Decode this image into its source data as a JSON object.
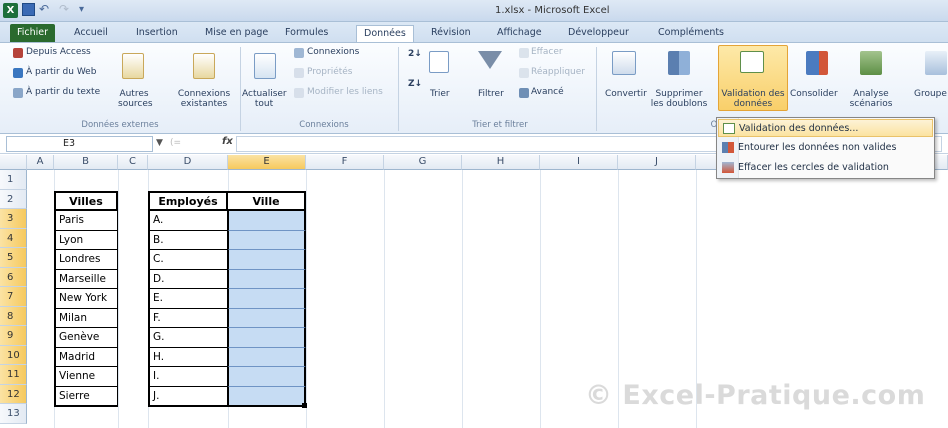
{
  "window": {
    "title": "1.xlsx - Microsoft Excel",
    "logo": "X"
  },
  "tabs": [
    {
      "label": "Fichier"
    },
    {
      "label": "Accueil"
    },
    {
      "label": "Insertion"
    },
    {
      "label": "Mise en page"
    },
    {
      "label": "Formules"
    },
    {
      "label": "Données"
    },
    {
      "label": "Révision"
    },
    {
      "label": "Affichage"
    },
    {
      "label": "Développeur"
    },
    {
      "label": "Compléments"
    }
  ],
  "ribbon": {
    "external": {
      "from_access": "Depuis Access",
      "from_web": "À partir du Web",
      "from_text": "À partir du texte",
      "other_sources": "Autres",
      "other_sources2": "sources",
      "existing": "Connexions",
      "existing2": "existantes",
      "label": "Données externes"
    },
    "connections": {
      "refresh": "Actualiser",
      "refresh2": "tout",
      "connections": "Connexions",
      "properties": "Propriétés",
      "edit_links": "Modifier les liens",
      "label": "Connexions"
    },
    "sort": {
      "sort": "Trier",
      "filter": "Filtrer",
      "clear": "Effacer",
      "reapply": "Réappliquer",
      "advanced": "Avancé",
      "label": "Trier et filtrer"
    },
    "tools": {
      "convert": "Convertir",
      "remove_dup": "Supprimer",
      "remove_dup2": "les doublons",
      "validation": "Validation des",
      "validation2": "données",
      "consolidate": "Consolider",
      "whatif": "Analyse",
      "whatif2": "scénarios",
      "group": "Groupe",
      "label_partial": "O"
    }
  },
  "formula_bar": {
    "name_box": "E3",
    "fx": "fx",
    "cancel": "",
    "value": ""
  },
  "columns": [
    "A",
    "B",
    "C",
    "D",
    "E",
    "F",
    "G",
    "H",
    "I",
    "J"
  ],
  "rows": [
    "1",
    "2",
    "3",
    "4",
    "5",
    "6",
    "7",
    "8",
    "9",
    "10",
    "11",
    "12",
    "13"
  ],
  "table1": {
    "header": "Villes",
    "values": [
      "Paris",
      "Lyon",
      "Londres",
      "Marseille",
      "New York",
      "Milan",
      "Genève",
      "Madrid",
      "Vienne",
      "Sierre"
    ]
  },
  "table2": {
    "header_emp": "Employés",
    "header_ville": "Ville",
    "employees": [
      "A.",
      "B.",
      "C.",
      "D.",
      "E.",
      "F.",
      "G.",
      "H.",
      "I.",
      "J."
    ]
  },
  "menu": {
    "items": [
      {
        "label": "Validation des données..."
      },
      {
        "label": "Entourer les données non valides"
      },
      {
        "label": "Effacer les cercles de validation"
      }
    ]
  },
  "watermark": "© Excel-Pratique.com",
  "colors": {
    "selection": "#c6dcf3",
    "file_tab": "#2a6a2e",
    "highlight": "#f9cf6a"
  }
}
